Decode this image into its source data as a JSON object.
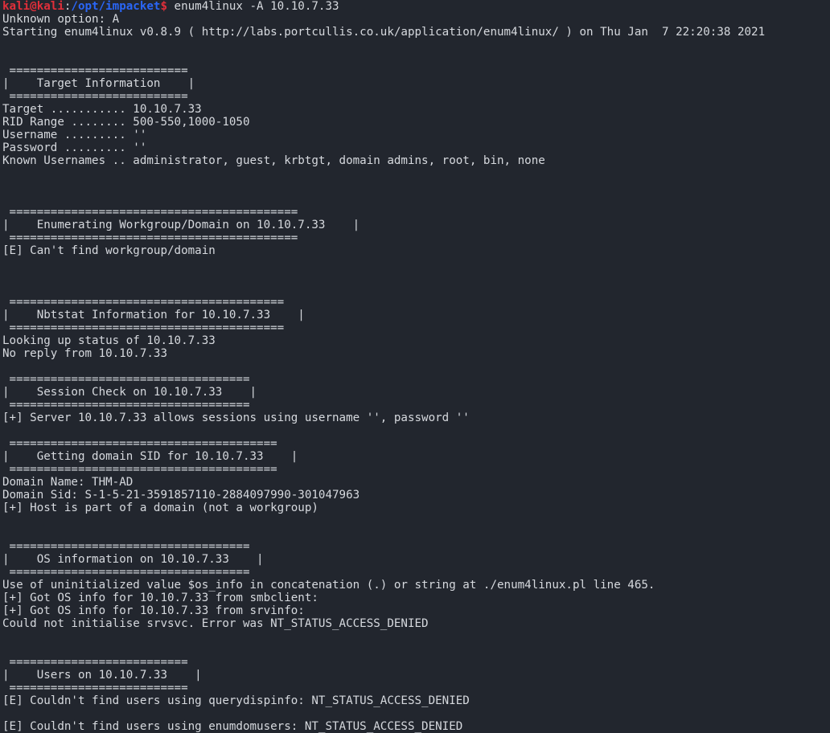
{
  "terminal": {
    "window_title": "enum4linux terminal output",
    "background_color": "#22262e",
    "foreground_color": "#d6d9de",
    "prompt": {
      "user_host": "kali@kali",
      "separator": ":",
      "path": "/opt/impacket",
      "sigil": "$",
      "user_host_color": "#e02f3a",
      "path_color": "#2a66f6",
      "sigil_color": "#e02f3a"
    },
    "command": " enum4linux -A 10.10.7.33",
    "lines": [
      "Unknown option: A",
      "Starting enum4linux v0.8.9 ( http://labs.portcullis.co.uk/application/enum4linux/ ) on Thu Jan  7 22:20:38 2021",
      "",
      "",
      " ==========================",
      "|    Target Information    |",
      " ==========================",
      "Target ........... 10.10.7.33",
      "RID Range ........ 500-550,1000-1050",
      "Username ......... ''",
      "Password ......... ''",
      "Known Usernames .. administrator, guest, krbtgt, domain admins, root, bin, none",
      "",
      "",
      "",
      " ==========================================",
      "|    Enumerating Workgroup/Domain on 10.10.7.33    |",
      " ==========================================",
      "[E] Can't find workgroup/domain",
      "",
      "",
      "",
      " ========================================",
      "|    Nbtstat Information for 10.10.7.33    |",
      " ========================================",
      "Looking up status of 10.10.7.33",
      "No reply from 10.10.7.33",
      "",
      " ===================================",
      "|    Session Check on 10.10.7.33    |",
      " ===================================",
      "[+] Server 10.10.7.33 allows sessions using username '', password ''",
      "",
      " =======================================",
      "|    Getting domain SID for 10.10.7.33    |",
      " =======================================",
      "Domain Name: THM-AD",
      "Domain Sid: S-1-5-21-3591857110-2884097990-301047963",
      "[+] Host is part of a domain (not a workgroup)",
      "",
      "",
      " ===================================",
      "|    OS information on 10.10.7.33    |",
      " ===================================",
      "Use of uninitialized value $os_info in concatenation (.) or string at ./enum4linux.pl line 465.",
      "[+] Got OS info for 10.10.7.33 from smbclient: ",
      "[+] Got OS info for 10.10.7.33 from srvinfo:",
      "Could not initialise srvsvc. Error was NT_STATUS_ACCESS_DENIED",
      "",
      "",
      " ==========================",
      "|    Users on 10.10.7.33    |",
      " ==========================",
      "[E] Couldn't find users using querydispinfo: NT_STATUS_ACCESS_DENIED",
      "",
      "[E] Couldn't find users using enumdomusers: NT_STATUS_ACCESS_DENIED"
    ]
  }
}
